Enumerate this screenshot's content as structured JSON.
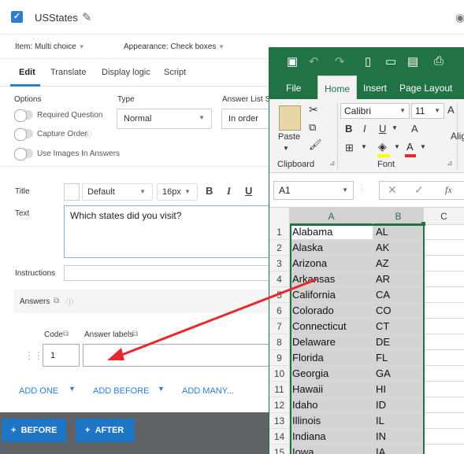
{
  "question": {
    "name": "USStates"
  },
  "item": {
    "label": "Item:",
    "value": "Multi choice"
  },
  "appearance": {
    "label": "Appearance:",
    "value": "Check boxes"
  },
  "tabs": [
    {
      "label": "Edit"
    },
    {
      "label": "Translate"
    },
    {
      "label": "Display logic"
    },
    {
      "label": "Script"
    }
  ],
  "options": {
    "title": "Options",
    "items": [
      {
        "label": "Required Question"
      },
      {
        "label": "Capture Order"
      },
      {
        "label": "Use Images In Answers"
      }
    ]
  },
  "type": {
    "label": "Type",
    "value": "Normal"
  },
  "answer_list": {
    "label": "Answer List So",
    "value": "In order"
  },
  "title_field": {
    "label": "Title",
    "font": "Default",
    "size": "16px"
  },
  "text_field": {
    "label": "Text",
    "value": "Which states did you visit?"
  },
  "instructions": {
    "label": "Instructions"
  },
  "answers": {
    "label": "Answers",
    "code_label": "Code",
    "answer_labels_label": "Answer labels",
    "code_value": "1"
  },
  "actions": {
    "add_one": "ADD ONE",
    "add_before": "ADD BEFORE",
    "add_many": "ADD MANY...",
    "before": "BEFORE",
    "after": "AFTER"
  },
  "excel": {
    "ribbon_tabs": [
      "File",
      "Home",
      "Insert",
      "Page Layout"
    ],
    "paste_label": "Paste",
    "clipboard_label": "Clipboard",
    "font_label": "Font",
    "font_name": "Calibri",
    "font_size": "11",
    "alignment_partial": "Alig",
    "name_box": "A1",
    "fx": "fx",
    "columns": [
      "A",
      "B",
      "C"
    ],
    "rows": [
      {
        "n": "1",
        "a": "Alabama",
        "b": "AL"
      },
      {
        "n": "2",
        "a": "Alaska",
        "b": "AK"
      },
      {
        "n": "3",
        "a": "Arizona",
        "b": "AZ"
      },
      {
        "n": "4",
        "a": "Arkansas",
        "b": "AR"
      },
      {
        "n": "5",
        "a": "California",
        "b": "CA"
      },
      {
        "n": "6",
        "a": "Colorado",
        "b": "CO"
      },
      {
        "n": "7",
        "a": "Connecticut",
        "b": "CT"
      },
      {
        "n": "8",
        "a": "Delaware",
        "b": "DE"
      },
      {
        "n": "9",
        "a": "Florida",
        "b": "FL"
      },
      {
        "n": "10",
        "a": "Georgia",
        "b": "GA"
      },
      {
        "n": "11",
        "a": "Hawaii",
        "b": "HI"
      },
      {
        "n": "12",
        "a": "Idaho",
        "b": "ID"
      },
      {
        "n": "13",
        "a": "Illinois",
        "b": "IL"
      },
      {
        "n": "14",
        "a": "Indiana",
        "b": "IN"
      },
      {
        "n": "15",
        "a": "Iowa",
        "b": "IA"
      }
    ]
  },
  "colors": {
    "accent": "#2d7ed3",
    "excel_green": "#217346",
    "arrow": "#e8282d"
  }
}
